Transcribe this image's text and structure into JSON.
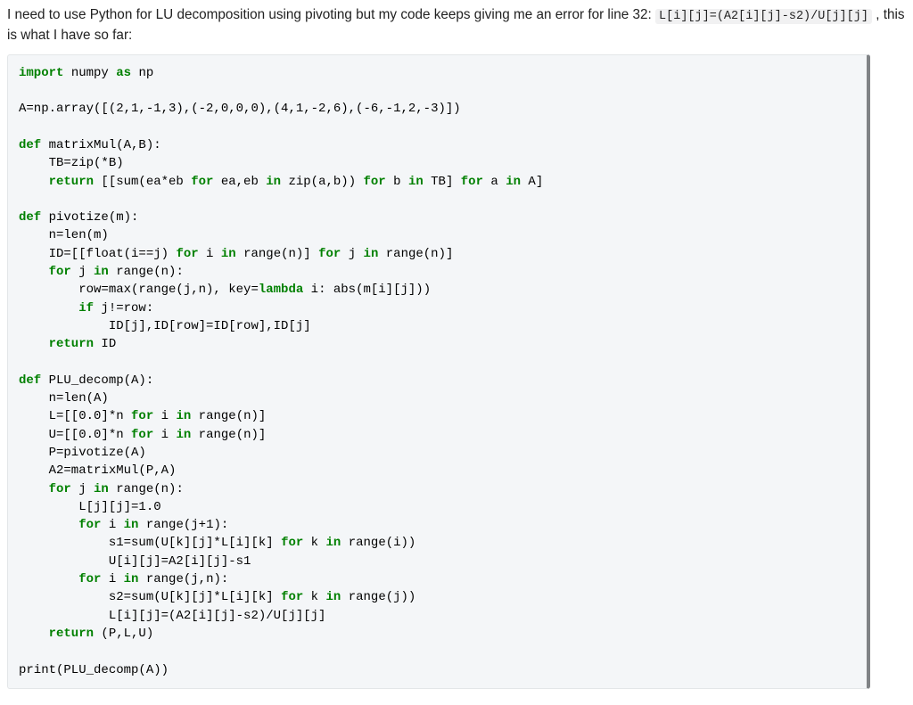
{
  "question": {
    "prefix": "I need to use Python for LU decomposition using pivoting but my code keeps giving me an error for line 32: ",
    "inline_code": "L[i][j]=(A2[i][j]-s2)/U[j][j]",
    "suffix": " , this is what I have so far:"
  },
  "code": {
    "line01_import": "import",
    "line01_numpy": " numpy ",
    "line01_as": "as",
    "line01_np": " np",
    "line03": "A=np.array([(2,1,-1,3),(-2,0,0,0),(4,1,-2,6),(-6,-1,2,-3)])",
    "line05_def": "def",
    "line05_rest": " matrixMul(A,B):",
    "line06": "    TB=zip(*B)",
    "line07_return": "    return",
    "line07_rest": " [[sum(ea*eb ",
    "line07_for": "for",
    "line07_rest2": " ea,eb ",
    "line07_in": "in",
    "line07_rest3": " zip(a,b)) ",
    "line07_for2": "for",
    "line07_rest4": " b ",
    "line07_in2": "in",
    "line07_rest5": " TB] ",
    "line07_for3": "for",
    "line07_rest6": " a ",
    "line07_in3": "in",
    "line07_rest7": " A]",
    "line09_def": "def",
    "line09_rest": " pivotize(m):",
    "line10": "    n=len(m)",
    "line11_pre": "    ID=[[float(i==j) ",
    "line11_for": "for",
    "line11_mid": " i ",
    "line11_in": "in",
    "line11_mid2": " range(n)] ",
    "line11_for2": "for",
    "line11_mid3": " j ",
    "line11_in2": "in",
    "line11_rest": " range(n)]",
    "line12_for": "    for",
    "line12_rest": " j ",
    "line12_in": "in",
    "line12_rest2": " range(n):",
    "line13_pre": "        row=max(range(j,n), key=",
    "line13_lambda": "lambda",
    "line13_rest": " i: abs(m[i][j]))",
    "line14_if": "        if",
    "line14_rest": " j!=row:",
    "line15": "            ID[j],ID[row]=ID[row],ID[j]",
    "line16_return": "    return",
    "line16_rest": " ID",
    "line18_def": "def",
    "line18_rest": " PLU_decomp(A):",
    "line19": "    n=len(A)",
    "line20_pre": "    L=[[0.0]*n ",
    "line20_for": "for",
    "line20_mid": " i ",
    "line20_in": "in",
    "line20_rest": " range(n)]",
    "line21_pre": "    U=[[0.0]*n ",
    "line21_for": "for",
    "line21_mid": " i ",
    "line21_in": "in",
    "line21_rest": " range(n)]",
    "line22": "    P=pivotize(A)",
    "line23": "    A2=matrixMul(P,A)",
    "line24_for": "    for",
    "line24_mid": " j ",
    "line24_in": "in",
    "line24_rest": " range(n):",
    "line25": "        L[j][j]=1.0",
    "line26_for": "        for",
    "line26_mid": " i ",
    "line26_in": "in",
    "line26_rest": " range(j+1):",
    "line27_pre": "            s1=sum(U[k][j]*L[i][k] ",
    "line27_for": "for",
    "line27_mid": " k ",
    "line27_in": "in",
    "line27_rest": " range(i))",
    "line28": "            U[i][j]=A2[i][j]-s1",
    "line29_for": "        for",
    "line29_mid": " i ",
    "line29_in": "in",
    "line29_rest": " range(j,n):",
    "line30_pre": "            s2=sum(U[k][j]*L[i][k] ",
    "line30_for": "for",
    "line30_mid": " k ",
    "line30_in": "in",
    "line30_rest": " range(j))",
    "line31": "            L[i][j]=(A2[i][j]-s2)/U[j][j]",
    "line32_return": "    return",
    "line32_rest": " (P,L,U)",
    "line34": "print(PLU_decomp(A))"
  }
}
